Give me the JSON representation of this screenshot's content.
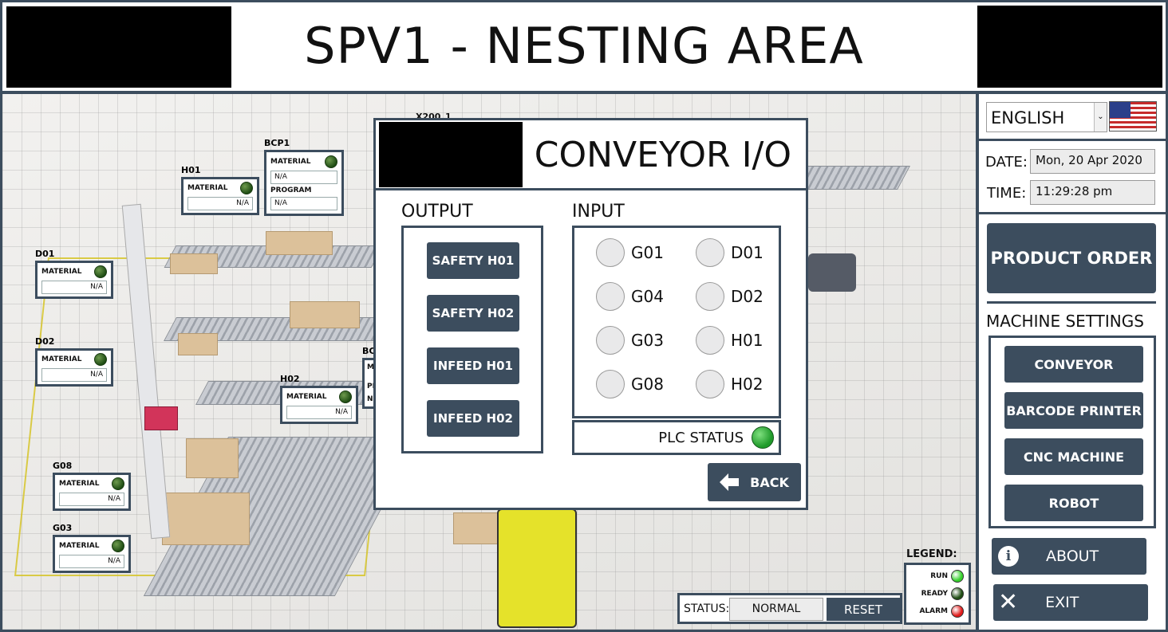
{
  "header": {
    "title": "SPV1 - NESTING AREA"
  },
  "scene": {
    "overlay_label": "X200_1",
    "partial_label": "BC",
    "partial_sub": [
      "M",
      "PI",
      "N"
    ],
    "tags": {
      "bcp1": {
        "name": "BCP1",
        "material_label": "MATERIAL",
        "material_value": "N/A",
        "program_label": "PROGRAM",
        "program_value": "N/A"
      },
      "h01": {
        "name": "H01",
        "material_label": "MATERIAL",
        "value": "N/A"
      },
      "d01": {
        "name": "D01",
        "material_label": "MATERIAL",
        "value": "N/A"
      },
      "d02": {
        "name": "D02",
        "material_label": "MATERIAL",
        "value": "N/A"
      },
      "h02": {
        "name": "H02",
        "material_label": "MATERIAL",
        "value": "N/A"
      },
      "g08": {
        "name": "G08",
        "material_label": "MATERIAL",
        "value": "N/A"
      },
      "g03": {
        "name": "G03",
        "material_label": "MATERIAL",
        "value": "N/A"
      }
    }
  },
  "dialog": {
    "title": "CONVEYOR I/O",
    "output_label": "OUTPUT",
    "input_label": "INPUT",
    "outputs": [
      "SAFETY H01",
      "SAFETY H02",
      "INFEED H01",
      "INFEED H02"
    ],
    "inputs": [
      "G01",
      "D01",
      "G04",
      "D02",
      "G03",
      "H01",
      "G08",
      "H02"
    ],
    "plc_status_label": "PLC STATUS",
    "plc_status_color": "#1f9a2a",
    "back_label": "BACK"
  },
  "rightpanel": {
    "language": "ENGLISH",
    "date_label": "DATE:",
    "date_value": "Mon, 20 Apr 2020",
    "time_label": "TIME:",
    "time_value": "11:29:28 pm",
    "product_order": "PRODUCT ORDER",
    "machine_settings_label": "MACHINE SETTINGS",
    "machine_buttons": [
      "CONVEYOR",
      "BARCODE PRINTER",
      "CNC MACHINE",
      "ROBOT"
    ],
    "about": "ABOUT",
    "exit": "EXIT"
  },
  "statusbar": {
    "label": "STATUS:",
    "value": "NORMAL",
    "reset": "RESET"
  },
  "legend": {
    "title": "LEGEND:",
    "items": [
      {
        "label": "RUN",
        "color": "#35d12c"
      },
      {
        "label": "READY",
        "color": "#1f4d14"
      },
      {
        "label": "ALARM",
        "color": "#e01b1b"
      }
    ]
  },
  "colors": {
    "frame": "#3c4d5e",
    "button": "#3c4d5e"
  }
}
